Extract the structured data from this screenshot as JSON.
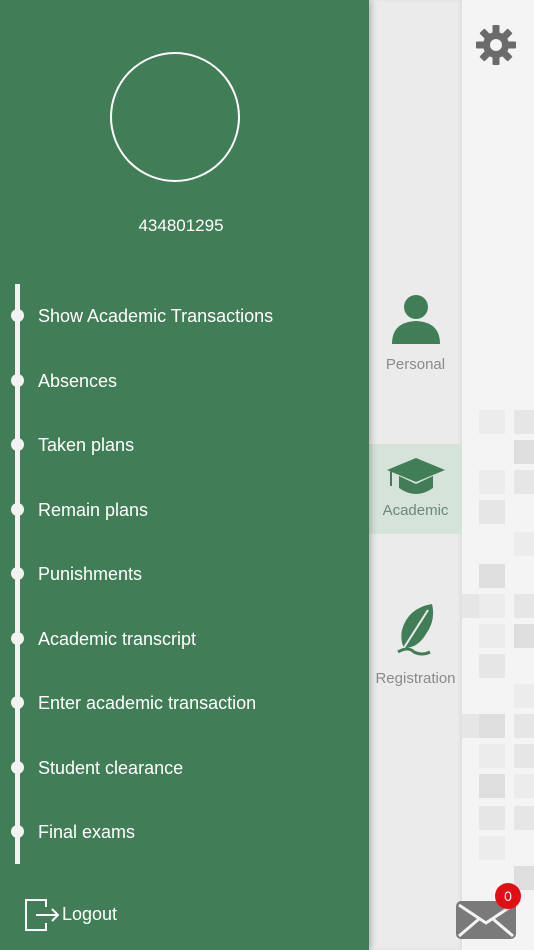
{
  "profile": {
    "student_id": "434801295"
  },
  "menu": {
    "items": [
      {
        "label": "Show Academic Transactions"
      },
      {
        "label": "Absences"
      },
      {
        "label": "Taken plans"
      },
      {
        "label": "Remain plans"
      },
      {
        "label": "Punishments"
      },
      {
        "label": "Academic transcript"
      },
      {
        "label": "Enter academic transaction"
      },
      {
        "label": "Student clearance"
      },
      {
        "label": "Final exams"
      }
    ],
    "logout_label": "Logout"
  },
  "tabs": [
    {
      "label": "Personal",
      "icon": "person-icon"
    },
    {
      "label": "Academic",
      "icon": "graduation-cap-icon",
      "active": true
    },
    {
      "label": "Registration",
      "icon": "feather-icon"
    }
  ],
  "messages": {
    "unread_count": "0"
  },
  "colors": {
    "drawer": "#417e58",
    "accent": "#417e58",
    "badge": "#e30d14"
  }
}
